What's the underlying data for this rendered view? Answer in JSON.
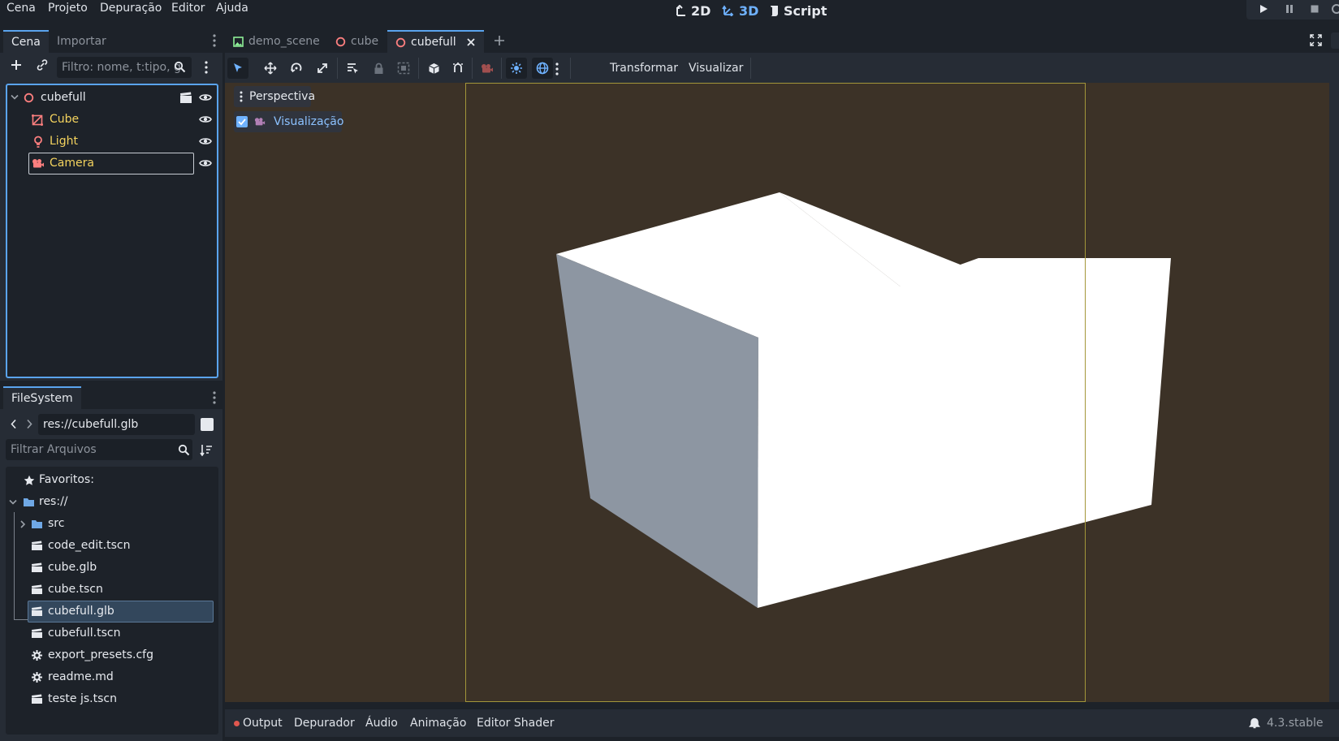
{
  "menu": {
    "items": [
      "Cena",
      "Projeto",
      "Depuração",
      "Editor",
      "Ajuda"
    ]
  },
  "workspaces": {
    "ws_2d": "2D",
    "ws_3d": "3D",
    "ws_script": "Script",
    "active": "3D"
  },
  "scene_dock": {
    "tabs": [
      "Cena",
      "Importar"
    ],
    "filter_placeholder": "Filtro: nome, t:tipo, g",
    "tree": [
      {
        "label": "cubefull",
        "icon": "node3d-icon",
        "color": "#e6e9ee"
      },
      {
        "label": "Cube",
        "icon": "mesh-instance-icon",
        "color": "#f4d35e"
      },
      {
        "label": "Light",
        "icon": "light-icon",
        "color": "#f4d35e"
      },
      {
        "label": "Camera",
        "icon": "camera-icon",
        "color": "#f4d35e"
      }
    ]
  },
  "filesystem": {
    "tab": "FileSystem",
    "path": "res://cubefull.glb",
    "filter_placeholder": "Filtrar Arquivos",
    "favorites": "Favoritos:",
    "root": "res://",
    "items": [
      {
        "label": "src",
        "type": "folder"
      },
      {
        "label": "code_edit.tscn",
        "type": "scene"
      },
      {
        "label": "cube.glb",
        "type": "scene"
      },
      {
        "label": "cube.tscn",
        "type": "scene"
      },
      {
        "label": "cubefull.glb",
        "type": "scene",
        "selected": true
      },
      {
        "label": "cubefull.tscn",
        "type": "scene"
      },
      {
        "label": "export_presets.cfg",
        "type": "config"
      },
      {
        "label": "readme.md",
        "type": "text"
      },
      {
        "label": "teste js.tscn",
        "type": "scene"
      }
    ]
  },
  "editor_tabs": [
    {
      "label": "demo_scene",
      "icon": "image-icon",
      "active": false
    },
    {
      "label": "cube",
      "icon": "node3d-icon",
      "active": false
    },
    {
      "label": "cubefull",
      "icon": "node3d-icon",
      "active": true
    }
  ],
  "viewport_toolbar": {
    "transform_menu": "Transformar",
    "view_menu": "Visualizar"
  },
  "viewport": {
    "perspective": "Perspectiva",
    "preview_label": "Visualização",
    "preview_checked": true
  },
  "bottom_panel": {
    "items": [
      "Output",
      "Depurador",
      "Áudio",
      "Animação",
      "Editor Shader"
    ],
    "version": "4.3.stable"
  },
  "colors": {
    "accent": "#5aa4ee",
    "viewport_bg": "#3c3227",
    "node_yellow": "#f4d35e",
    "output_dot": "#e0574f"
  }
}
